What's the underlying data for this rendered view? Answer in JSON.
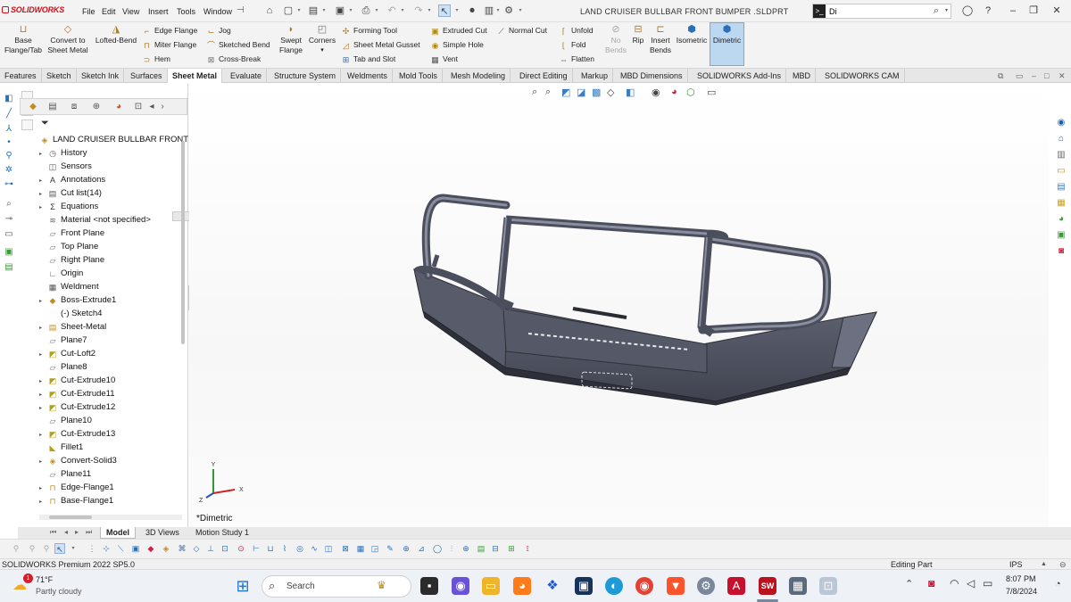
{
  "app": {
    "logo_text": "SOLIDWORKS",
    "document_title": "LAND CRUISER BULLBAR FRONT BUMPER .SLDPRT"
  },
  "menu": [
    "File",
    "Edit",
    "View",
    "Insert",
    "Tools",
    "Window"
  ],
  "search": {
    "value": "Di",
    "prompt_symbol": ">_"
  },
  "ribbon": {
    "base_flange": "Base\nFlange/Tab",
    "convert_sheet": "Convert to\nSheet Metal",
    "lofted_bend": "Lofted-Bend",
    "col1": [
      "Edge Flange",
      "Miter Flange",
      "Hem"
    ],
    "col2": [
      "Jog",
      "Sketched Bend",
      "Cross-Break"
    ],
    "swept_flange": "Swept\nFlange",
    "corners": "Corners",
    "col3": [
      "Forming Tool",
      "Sheet Metal Gusset",
      "Tab and Slot"
    ],
    "col4": [
      "Extruded Cut",
      "Simple Hole",
      "Vent"
    ],
    "normal_cut": "Normal Cut",
    "col5": [
      "Unfold",
      "Fold",
      "Flatten"
    ],
    "no_bends": "No\nBends",
    "rip": "Rip",
    "insert_bends": "Insert\nBends",
    "isometric": "Isometric",
    "dimetric": "Dimetric"
  },
  "tabs": [
    "Features",
    "Sketch",
    "Sketch Ink",
    "Surfaces",
    "Sheet Metal",
    "Evaluate",
    "Structure System",
    "Weldments",
    "Mold Tools",
    "Mesh Modeling",
    "Direct Editing",
    "Markup",
    "MBD Dimensions",
    "SOLIDWORKS Add-Ins",
    "MBD",
    "SOLIDWORKS CAM"
  ],
  "active_tab": "Sheet Metal",
  "tree": {
    "root": "LAND CRUISER BULLBAR FRONT E",
    "items": [
      {
        "label": "History",
        "icon": "history-icon",
        "expand": true
      },
      {
        "label": "Sensors",
        "icon": "sensor-icon",
        "expand": false
      },
      {
        "label": "Annotations",
        "icon": "annotation-icon",
        "expand": true
      },
      {
        "label": "Cut list(14)",
        "icon": "cutlist-icon",
        "expand": true
      },
      {
        "label": "Equations",
        "icon": "equation-icon",
        "expand": true
      },
      {
        "label": "Material <not specified>",
        "icon": "material-icon",
        "expand": false
      },
      {
        "label": "Front Plane",
        "icon": "plane-icon",
        "expand": false
      },
      {
        "label": "Top Plane",
        "icon": "plane-icon",
        "expand": false
      },
      {
        "label": "Right Plane",
        "icon": "plane-icon",
        "expand": false
      },
      {
        "label": "Origin",
        "icon": "origin-icon",
        "expand": false
      },
      {
        "label": "Weldment",
        "icon": "weldment-icon",
        "expand": false
      },
      {
        "label": "Boss-Extrude1",
        "icon": "extrude-icon",
        "expand": true
      },
      {
        "label": "(-) Sketch4",
        "icon": "sketch-icon",
        "expand": false
      },
      {
        "label": "Sheet-Metal",
        "icon": "sheetmetal-icon",
        "expand": true
      },
      {
        "label": "Plane7",
        "icon": "plane-icon",
        "expand": false
      },
      {
        "label": "Cut-Loft2",
        "icon": "cut-icon",
        "expand": true
      },
      {
        "label": "Plane8",
        "icon": "plane-icon",
        "expand": false
      },
      {
        "label": "Cut-Extrude10",
        "icon": "cut-icon",
        "expand": true
      },
      {
        "label": "Cut-Extrude11",
        "icon": "cut-icon",
        "expand": true
      },
      {
        "label": "Cut-Extrude12",
        "icon": "cut-icon",
        "expand": true
      },
      {
        "label": "Plane10",
        "icon": "plane-icon",
        "expand": false
      },
      {
        "label": "Cut-Extrude13",
        "icon": "cut-icon",
        "expand": true
      },
      {
        "label": "Fillet1",
        "icon": "fillet-icon",
        "expand": false
      },
      {
        "label": "Convert-Solid3",
        "icon": "convert-icon",
        "expand": true
      },
      {
        "label": "Plane11",
        "icon": "plane-icon",
        "expand": false
      },
      {
        "label": "Edge-Flange1",
        "icon": "flange-icon",
        "expand": true
      },
      {
        "label": "Base-Flange1",
        "icon": "flange-icon",
        "expand": true
      }
    ]
  },
  "viewport": {
    "view_label": "*Dimetric",
    "triad": {
      "x": "X",
      "y": "Y",
      "z": "Z"
    }
  },
  "bottom_tabs": [
    "Model",
    "3D Views",
    "Motion Study 1"
  ],
  "active_bottom_tab": "Model",
  "status": {
    "version": "SOLIDWORKS Premium 2022 SP5.0",
    "mode": "Editing Part",
    "units": "IPS"
  },
  "taskbar": {
    "weather_temp": "71°F",
    "weather_desc": "Partly cloudy",
    "search_placeholder": "Search",
    "time": "8:07 PM",
    "date": "7/8/2024",
    "notification_badge": "1"
  },
  "colors": {
    "accent": "#2b6fb6",
    "sw_red": "#d0101a",
    "active_view": "#bcd7f0",
    "model": "#5a5e6e"
  }
}
